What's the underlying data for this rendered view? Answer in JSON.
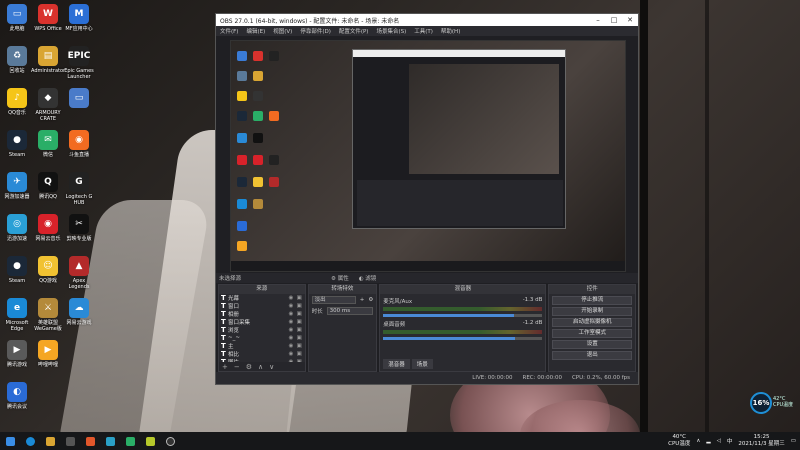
{
  "desktop_icons": [
    {
      "label": "此电脑",
      "glyph": "▭",
      "color": "#3a7bd5"
    },
    {
      "label": "WPS Office",
      "glyph": "W",
      "color": "#d9322d"
    },
    {
      "label": "MF应用中心",
      "glyph": "M",
      "color": "#2b6fd6"
    },
    {
      "label": "回收站",
      "glyph": "♻",
      "color": "#5a7a9a"
    },
    {
      "label": "Administrator",
      "glyph": "▤",
      "color": "#d9a533"
    },
    {
      "label": "Epic Games Launcher",
      "glyph": "EPIC",
      "color": "#222"
    },
    {
      "label": "QQ音乐",
      "glyph": "♪",
      "color": "#f5c518"
    },
    {
      "label": "ARMOURY CRATE",
      "glyph": "◆",
      "color": "#333"
    },
    {
      "label": "",
      "glyph": "▭",
      "color": "#4a7bc9"
    },
    {
      "label": "Steam",
      "glyph": "●",
      "color": "#1b2838"
    },
    {
      "label": "微信",
      "glyph": "✉",
      "color": "#2aae67"
    },
    {
      "label": "斗鱼直播",
      "glyph": "◉",
      "color": "#f26b21"
    },
    {
      "label": "网游加速器",
      "glyph": "✈",
      "color": "#2a8ad6"
    },
    {
      "label": "腾讯QQ",
      "glyph": "Q",
      "color": "#111"
    },
    {
      "label": "Logitech G HUB",
      "glyph": "G",
      "color": "#222"
    },
    {
      "label": "迅游加速",
      "glyph": "◎",
      "color": "#2aa0d6"
    },
    {
      "label": "网易云音乐",
      "glyph": "◉",
      "color": "#d8222a"
    },
    {
      "label": "剪映专业版",
      "glyph": "✂",
      "color": "#111"
    },
    {
      "label": "Steam",
      "glyph": "●",
      "color": "#1b2838"
    },
    {
      "label": "QQ游戏",
      "glyph": "☺",
      "color": "#f1c232"
    },
    {
      "label": "Apex Legends",
      "glyph": "▲",
      "color": "#b32a2a"
    },
    {
      "label": "Microsoft Edge",
      "glyph": "e",
      "color": "#1a8ad6"
    },
    {
      "label": "英雄联盟WeGame版",
      "glyph": "⚔",
      "color": "#b48a3a"
    },
    {
      "label": "网易云游戏",
      "glyph": "☁",
      "color": "#2a8ad6"
    },
    {
      "label": "腾讯游戏",
      "glyph": "▶",
      "color": "#5a5a5a"
    },
    {
      "label": "哔哩哔哩",
      "glyph": "▶",
      "color": "#f5a623"
    },
    {
      "label": "腾讯会议",
      "glyph": "◐",
      "color": "#2a6bd6"
    }
  ],
  "obs": {
    "title": "OBS 27.0.1 (64-bit, windows) - 配置文件: 未命名 - 场景: 未命名",
    "menu": [
      "文件(F)",
      "编辑(E)",
      "视图(V)",
      "停靠部件(D)",
      "配置文件(P)",
      "场景集合(S)",
      "工具(T)",
      "帮助(H)"
    ],
    "scene_label": "未选择源",
    "scene_buttons": [
      "属性",
      "滤镜"
    ],
    "docks": {
      "sources_title": "来源",
      "sources": [
        "光幕",
        "窗口",
        "相册",
        "窗口采集",
        "浏览",
        "~_~",
        "主",
        "相比",
        "图片"
      ],
      "transitions_title": "转场特效",
      "transition_type": "淡出",
      "duration_label": "时长",
      "duration_value": "300 ms",
      "mixer_title": "混音器",
      "mixer_channels": [
        {
          "name": "麦克风/Aux",
          "db": "-1.3 dB",
          "level": 0.82
        },
        {
          "name": "桌面音频",
          "db": "-1.2 dB",
          "level": 0.83
        }
      ],
      "mixer_tabs": [
        "混音器",
        "场景"
      ],
      "controls_title": "控件",
      "controls": [
        "停止推流",
        "开始录制",
        "启动虚拟摄像机",
        "工作室模式",
        "设置",
        "退出"
      ]
    },
    "status": {
      "live_label": "LIVE:",
      "live_time": "00:00:00",
      "rec_label": "REC:",
      "rec_time": "00:00:00",
      "cpu": "CPU: 0.2%, 60.00 fps"
    }
  },
  "widget": {
    "cpu_percent": "16%",
    "temp": "42°C",
    "temp_label": "CPU温度"
  },
  "taskbar": {
    "tray_temp": "40°C",
    "tray_temp_label": "CPU温度",
    "time": "15:25",
    "date": "2021/11/3 星期三"
  }
}
